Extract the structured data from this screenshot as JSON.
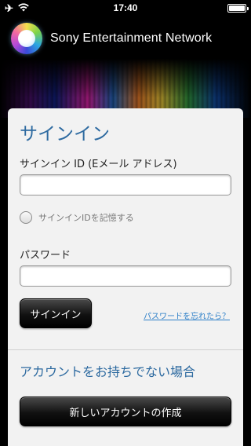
{
  "status_bar": {
    "time": "17:40",
    "airplane_icon": "✈",
    "wifi_icon": "wifi"
  },
  "header": {
    "brand": "Sony Entertainment Network"
  },
  "signin": {
    "title": "サインイン",
    "id_label": "サインイン ID (Eメール アドレス)",
    "id_value": "",
    "remember_label": "サインインIDを記憶する",
    "remember_checked": false,
    "password_label": "パスワード",
    "password_value": "",
    "signin_button": "サインイン",
    "forgot_link": "パスワードを忘れたら？"
  },
  "register": {
    "title": "アカウントをお持ちでない場合",
    "create_button": "新しいアカウントの作成"
  }
}
